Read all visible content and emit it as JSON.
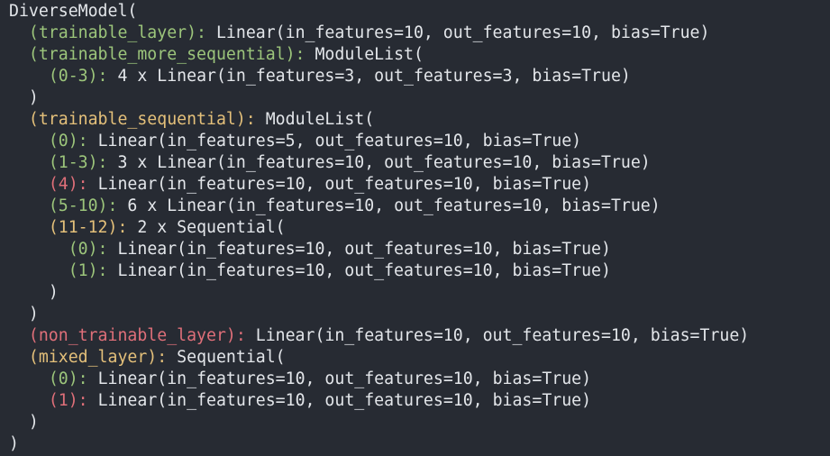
{
  "terminal": {
    "colors": {
      "background": "#272b33",
      "text": "#e3e6ea",
      "green": "#9cc57b",
      "yellow": "#e4c07a",
      "red": "#df6f79"
    },
    "lines": [
      {
        "indent": "",
        "segments": [
          {
            "text": "DiverseModel(",
            "color": "white"
          }
        ]
      },
      {
        "indent": "  ",
        "segments": [
          {
            "text": "(trainable_layer):",
            "color": "green"
          },
          {
            "text": " Linear(in_features=10, out_features=10, bias=True)",
            "color": "white"
          }
        ]
      },
      {
        "indent": "  ",
        "segments": [
          {
            "text": "(trainable_more_sequential):",
            "color": "green"
          },
          {
            "text": " ModuleList(",
            "color": "white"
          }
        ]
      },
      {
        "indent": "    ",
        "segments": [
          {
            "text": "(0-3):",
            "color": "green"
          },
          {
            "text": " 4 x Linear(in_features=3, out_features=3, bias=True)",
            "color": "white"
          }
        ]
      },
      {
        "indent": "  ",
        "segments": [
          {
            "text": ")",
            "color": "white"
          }
        ]
      },
      {
        "indent": "  ",
        "segments": [
          {
            "text": "(trainable_sequential):",
            "color": "yellow"
          },
          {
            "text": " ModuleList(",
            "color": "white"
          }
        ]
      },
      {
        "indent": "    ",
        "segments": [
          {
            "text": "(0):",
            "color": "green"
          },
          {
            "text": " Linear(in_features=5, out_features=10, bias=True)",
            "color": "white"
          }
        ]
      },
      {
        "indent": "    ",
        "segments": [
          {
            "text": "(1-3):",
            "color": "green"
          },
          {
            "text": " 3 x Linear(in_features=10, out_features=10, bias=True)",
            "color": "white"
          }
        ]
      },
      {
        "indent": "    ",
        "segments": [
          {
            "text": "(4):",
            "color": "red"
          },
          {
            "text": " Linear(in_features=10, out_features=10, bias=True)",
            "color": "white"
          }
        ]
      },
      {
        "indent": "    ",
        "segments": [
          {
            "text": "(5-10):",
            "color": "green"
          },
          {
            "text": " 6 x Linear(in_features=10, out_features=10, bias=True)",
            "color": "white"
          }
        ]
      },
      {
        "indent": "    ",
        "segments": [
          {
            "text": "(11-12):",
            "color": "yellow"
          },
          {
            "text": " 2 x Sequential(",
            "color": "white"
          }
        ]
      },
      {
        "indent": "      ",
        "segments": [
          {
            "text": "(0):",
            "color": "green"
          },
          {
            "text": " Linear(in_features=10, out_features=10, bias=True)",
            "color": "white"
          }
        ]
      },
      {
        "indent": "      ",
        "segments": [
          {
            "text": "(1):",
            "color": "green"
          },
          {
            "text": " Linear(in_features=10, out_features=10, bias=True)",
            "color": "white"
          }
        ]
      },
      {
        "indent": "    ",
        "segments": [
          {
            "text": ")",
            "color": "white"
          }
        ]
      },
      {
        "indent": "  ",
        "segments": [
          {
            "text": ")",
            "color": "white"
          }
        ]
      },
      {
        "indent": "  ",
        "segments": [
          {
            "text": "(non_trainable_layer):",
            "color": "red"
          },
          {
            "text": " Linear(in_features=10, out_features=10, bias=True)",
            "color": "white"
          }
        ]
      },
      {
        "indent": "  ",
        "segments": [
          {
            "text": "(mixed_layer):",
            "color": "yellow"
          },
          {
            "text": " Sequential(",
            "color": "white"
          }
        ]
      },
      {
        "indent": "    ",
        "segments": [
          {
            "text": "(0):",
            "color": "green"
          },
          {
            "text": " Linear(in_features=10, out_features=10, bias=True)",
            "color": "white"
          }
        ]
      },
      {
        "indent": "    ",
        "segments": [
          {
            "text": "(1):",
            "color": "red"
          },
          {
            "text": " Linear(in_features=10, out_features=10, bias=True)",
            "color": "white"
          }
        ]
      },
      {
        "indent": "  ",
        "segments": [
          {
            "text": ")",
            "color": "white"
          }
        ]
      },
      {
        "indent": "",
        "segments": [
          {
            "text": ")",
            "color": "white"
          }
        ]
      }
    ]
  }
}
